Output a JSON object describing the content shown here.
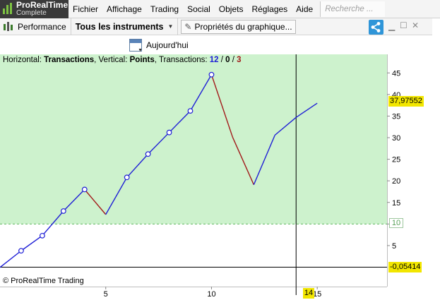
{
  "app": {
    "logo_line1": "ProRealTime",
    "logo_line2": "Complete",
    "colors": {
      "logo_bg": "#3a3a3a",
      "logo_green": "#7dc242",
      "share_blue": "#2f95d8"
    }
  },
  "menu": {
    "items": [
      "Fichier",
      "Affichage",
      "Trading",
      "Social",
      "Objets",
      "Réglages",
      "Aide"
    ],
    "search_placeholder": "Recherche ..."
  },
  "toolbar": {
    "performance_label": "Performance",
    "instruments_label": "Tous les instruments",
    "properties_label": "Propriétés du graphique...",
    "share_icon": "share-icon",
    "window_controls": [
      "minimize-icon",
      "maximize-icon",
      "close-icon"
    ]
  },
  "date_bar": {
    "today_label": "Aujourd'hui",
    "icon": "calendar-icon"
  },
  "chart_info": {
    "horizontal_prefix": "Horizontal: ",
    "horizontal_value": "Transactions",
    "vertical_prefix": ", Vertical: ",
    "vertical_value": "Points",
    "transactions_prefix": ", Transactions: ",
    "count_total": "12",
    "slash1": " / ",
    "count_neutral": "0",
    "slash2": " / ",
    "count_losing": "3",
    "copyright": "© ProRealTime Trading"
  },
  "price_labels": {
    "cursor_value": "37,97552",
    "threshold_value": "10",
    "last_value": "-0,05414",
    "x_cursor": "14"
  },
  "chart_data": {
    "type": "line",
    "x": [
      0,
      1,
      2,
      3,
      4,
      5,
      6,
      7,
      8,
      9,
      10,
      11,
      12,
      13,
      14,
      15
    ],
    "values": [
      -0.05,
      3.8,
      7.3,
      13,
      18,
      12.2,
      20.8,
      26.2,
      31.2,
      36.2,
      44.6,
      30.1,
      19.1,
      30.6,
      34.7,
      37.98
    ],
    "markers": [
      1,
      2,
      3,
      4,
      6,
      7,
      8,
      9,
      10
    ],
    "losing_segments": [
      [
        4,
        5
      ],
      [
        10,
        12
      ]
    ],
    "xlim": [
      0,
      18.3
    ],
    "ylim": [
      -4.5,
      49.3
    ],
    "x_ticks": [
      5,
      10,
      15
    ],
    "y_ticks": [
      5,
      10,
      15,
      20,
      25,
      30,
      35,
      40,
      45
    ],
    "threshold": 10,
    "baseline": 0,
    "cursor_x": 14,
    "colors": {
      "win_line": "#1f1fd6",
      "loss_line": "#a21a1a",
      "profit_zone": "#cdf2cd",
      "threshold_line": "#5fb85f",
      "baseline": "#000000"
    }
  }
}
